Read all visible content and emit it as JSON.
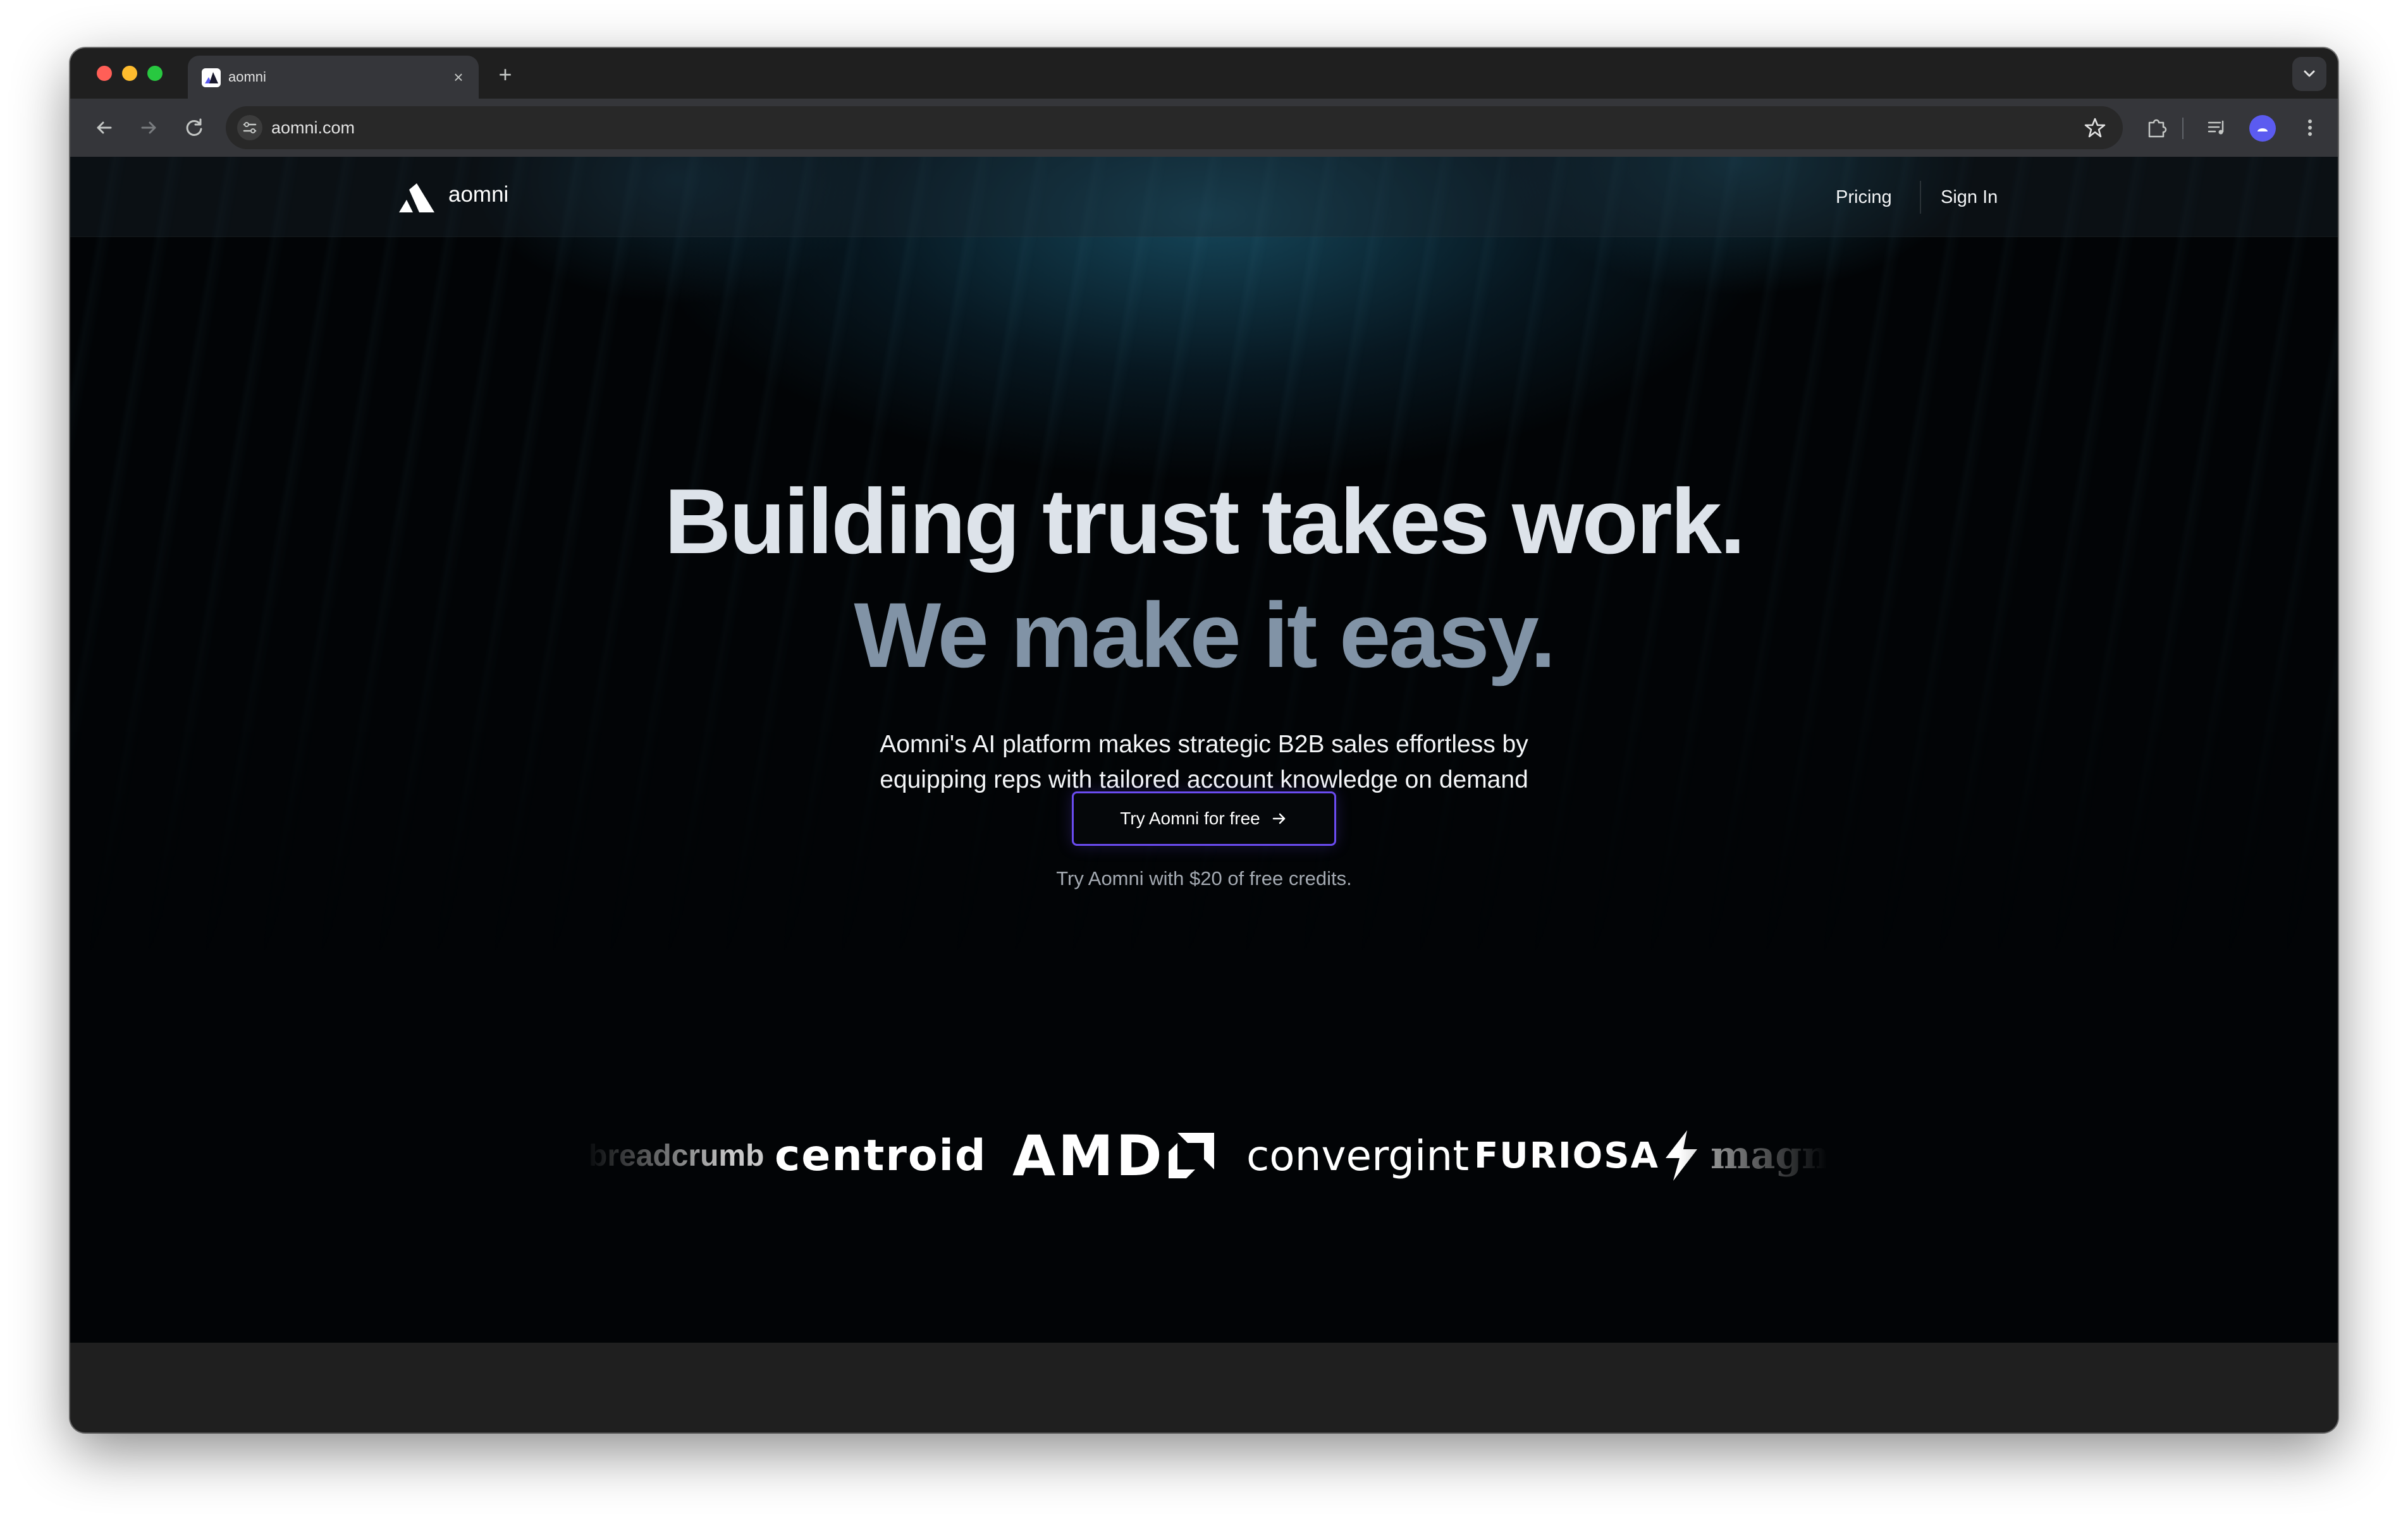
{
  "browser": {
    "tab_title": "aomni",
    "tab_close": "×",
    "new_tab": "+",
    "url": "aomni.com"
  },
  "site": {
    "brand": "aomni",
    "nav": {
      "pricing": "Pricing",
      "sign_in": "Sign In"
    },
    "hero": {
      "line1": "Building trust takes work.",
      "line2": "We make it easy.",
      "subtitle": "Aomni's AI platform makes strategic B2B sales effortless by equipping reps with tailored account knowledge on demand",
      "cta_label": "Try Aomni for free",
      "credits_note": "Try Aomni with $20 of free credits."
    },
    "customer_logos": [
      "breadcrumb",
      "centroid",
      "AMD",
      "convergint",
      "FURIOSA",
      "magno"
    ]
  },
  "colors": {
    "background": "#020406",
    "accent": "#6b4cf2",
    "headline": "#dde3ea",
    "headline_muted": "#8193a6"
  }
}
